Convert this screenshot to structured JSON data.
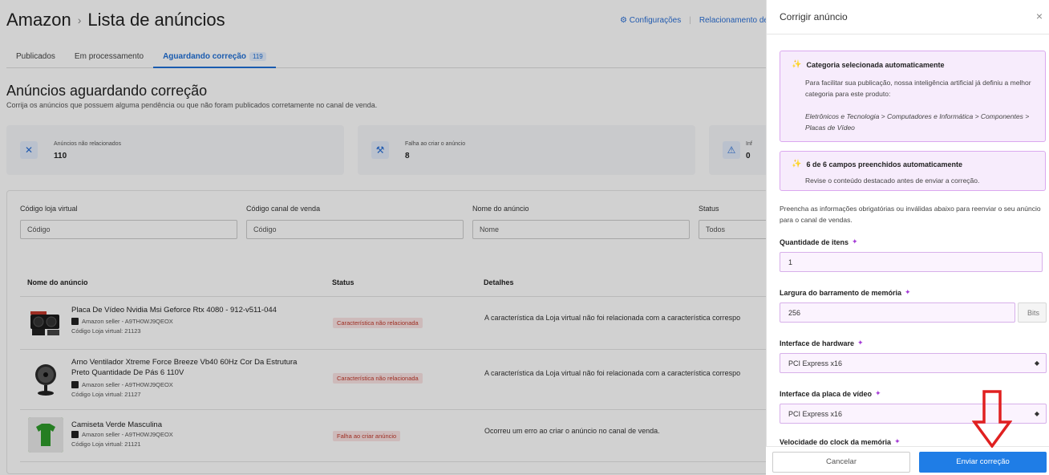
{
  "header": {
    "breadcrumb_root": "Amazon",
    "breadcrumb_sep": "›",
    "title": "Lista de anúncios",
    "link_settings": "Configurações",
    "link_relations": "Relacionamento de"
  },
  "tabs": [
    {
      "label": "Publicados"
    },
    {
      "label": "Em processamento"
    },
    {
      "label": "Aguardando correção",
      "count": "119"
    }
  ],
  "section": {
    "title": "Anúncios aguardando correção",
    "subtitle": "Corrija os anúncios que possuem alguma pendência ou que não foram publicados corretamente no canal de venda."
  },
  "stats": [
    {
      "label": "Anúncios não relacionados",
      "value": "110",
      "icon": "x-icon"
    },
    {
      "label": "Falha ao criar o anúncio",
      "value": "8",
      "icon": "tools-icon"
    },
    {
      "label": "Inf",
      "value": "0",
      "icon": "warning-icon"
    }
  ],
  "filters": [
    {
      "label": "Código loja virtual",
      "placeholder": "Código"
    },
    {
      "label": "Código canal de venda",
      "placeholder": "Código"
    },
    {
      "label": "Nome do anúncio",
      "placeholder": "Nome"
    },
    {
      "label": "Status",
      "value": "Todos"
    }
  ],
  "table": {
    "columns": [
      "Nome do anúncio",
      "Status",
      "Detalhes"
    ],
    "rows": [
      {
        "name": "Placa De Vídeo Nvidia Msi Geforce Rtx 4080 - 912-v511-044",
        "seller": "Amazon seller - A9TH0WJ9QEOX",
        "code": "Código Loja virtual: 21123",
        "status": "Característica não relacionada",
        "detail": "A característica da Loja virtual não foi relacionada com a característica correspo"
      },
      {
        "name": "Arno Ventilador Xtreme Force Breeze Vb40 60Hz Cor Da Estrutura Preto Quantidade De Pás 6 110V",
        "seller": "Amazon seller - A9TH0WJ9QEOX",
        "code": "Código Loja virtual: 21127",
        "status": "Característica não relacionada",
        "detail": "A característica da Loja virtual não foi relacionada com a característica correspo"
      },
      {
        "name": "Camiseta Verde Masculina",
        "seller": "Amazon seller - A9TH0WJ9QEOX",
        "code": "Código Loja virtual: 21121",
        "status": "Falha ao criar anúncio",
        "detail": "Ocorreu um erro ao criar o anúncio no canal de venda."
      }
    ]
  },
  "drawer": {
    "title": "Corrigir anúncio",
    "close": "×",
    "ai_category": {
      "title": "Categoria selecionada automaticamente",
      "text": "Para facilitar sua publicação, nossa inteligência artificial já definiu a melhor categoria para este produto:",
      "path": "Eletrônicos e Tecnologia > Computadores e Informática > Componentes > Placas de Vídeo"
    },
    "ai_fields": {
      "title": "6 de 6 campos preenchidos automaticamente",
      "text": "Revise o conteúdo destacado antes de enviar a correção."
    },
    "intro": "Preencha as informações obrigatórias ou inválidas abaixo para reenviar o seu anúncio para o canal de vendas.",
    "fields": [
      {
        "label": "Quantidade de itens",
        "value": "1"
      },
      {
        "label": "Largura do barramento de memória",
        "value": "256",
        "suffix": "Bits"
      },
      {
        "label": "Interface de hardware",
        "value": "PCI Express x16"
      },
      {
        "label": "Interface da placa de vídeo",
        "value": "PCI Express x16"
      },
      {
        "label": "Velocidade do clock da memória"
      }
    ],
    "cancel_label": "Cancelar",
    "submit_label": "Enviar correção"
  },
  "colors": {
    "accent": "#1f7de6",
    "ai_bg": "#f7ecfc",
    "ai_border": "#dba8ef",
    "error": "#c0392b",
    "annotation_arrow": "#e02020"
  }
}
